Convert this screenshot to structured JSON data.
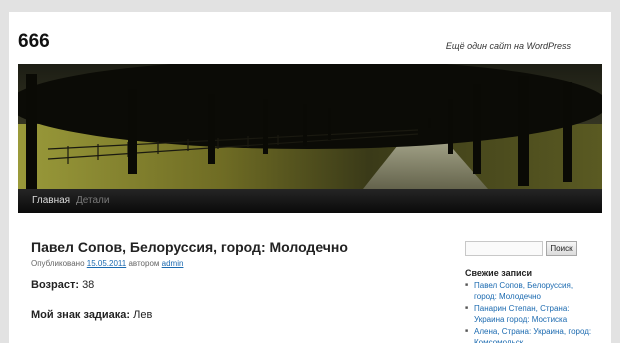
{
  "site": {
    "title": "666",
    "description": "Ещё один сайт на WordPress"
  },
  "nav": {
    "items": [
      {
        "label": "Главная"
      },
      {
        "label": "Детали"
      }
    ]
  },
  "post": {
    "title": "Павел Сопов, Белоруссия, город: Молодечно",
    "meta": {
      "published_prefix": "Опубликовано",
      "date": "15.05.2011",
      "author_prefix": "автором",
      "author": "admin"
    },
    "fields": [
      {
        "label": "Возраст:",
        "value": "38"
      },
      {
        "label": "Мой знак задиака:",
        "value": "Лев"
      }
    ]
  },
  "sidebar": {
    "search_button": "Поиск",
    "recent_title": "Свежие записи",
    "recent_posts": [
      "Павел Сопов, Белоруссия, город: Молодечно",
      "Панарин Степан, Страна: Украина город: Мостиска",
      "Алена, Страна: Украина, город: Комсомольск"
    ]
  },
  "colors": {
    "link": "#1b6ab0",
    "nav_bg": "#111111",
    "page_bg": "#e2e2e2"
  }
}
